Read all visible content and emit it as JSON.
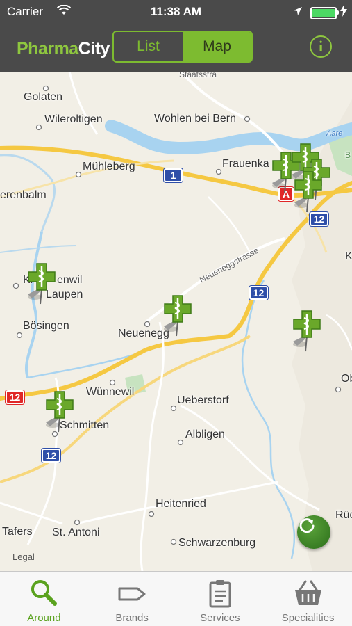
{
  "status_bar": {
    "carrier": "Carrier",
    "time": "11:38 AM",
    "wifi_icon": "wifi-icon",
    "location_icon": "location-arrow-icon",
    "battery_icon": "battery-charging-icon"
  },
  "nav": {
    "brand_part1": "Pharma",
    "brand_part2": "City",
    "segments": [
      {
        "label": "List",
        "selected": false
      },
      {
        "label": "Map",
        "selected": true
      }
    ],
    "info_label": "i"
  },
  "map": {
    "places": [
      {
        "name": "Golaten"
      },
      {
        "name": "Wileroltigen"
      },
      {
        "name": "Wohlen bei Bern"
      },
      {
        "name": "Mühleberg"
      },
      {
        "name": "Frauenka"
      },
      {
        "name": "erenbalm"
      },
      {
        "name": "Kr"
      },
      {
        "name": "enwil"
      },
      {
        "name": "Laupen"
      },
      {
        "name": "Bösingen"
      },
      {
        "name": "Neuenegg"
      },
      {
        "name": "Wünnewil"
      },
      {
        "name": "Ueberstorf"
      },
      {
        "name": "Schmitten"
      },
      {
        "name": "Albligen"
      },
      {
        "name": "Heitenried"
      },
      {
        "name": "Tafers"
      },
      {
        "name": "St. Antoni"
      },
      {
        "name": "Schwarzenburg"
      },
      {
        "name": "Rüeg"
      },
      {
        "name": "Ob"
      },
      {
        "name": "K"
      }
    ],
    "road_label": "Neueneggstrasse",
    "top_road_label": "Staatsstra",
    "river_label": "Aare",
    "edge_label": "B",
    "shields": [
      {
        "text": "1",
        "color": "blue"
      },
      {
        "text": "12",
        "color": "blue"
      },
      {
        "text": "12",
        "color": "blue"
      },
      {
        "text": "12",
        "color": "red"
      },
      {
        "text": "12",
        "color": "blue"
      },
      {
        "text": "A",
        "color": "red"
      }
    ],
    "pharmacy_pin_icon": "pharmacy-pin-icon",
    "legal_label": "Legal",
    "refresh_icon": "refresh-icon"
  },
  "tabs": [
    {
      "label": "Around",
      "icon": "search-icon",
      "active": true
    },
    {
      "label": "Brands",
      "icon": "tag-icon",
      "active": false
    },
    {
      "label": "Services",
      "icon": "clipboard-icon",
      "active": false
    },
    {
      "label": "Specialities",
      "icon": "basket-icon",
      "active": false
    }
  ],
  "colors": {
    "accent": "#7dbb30",
    "bar": "#4a4a4a",
    "road_major": "#f5c842",
    "water": "#a8d3f0"
  }
}
